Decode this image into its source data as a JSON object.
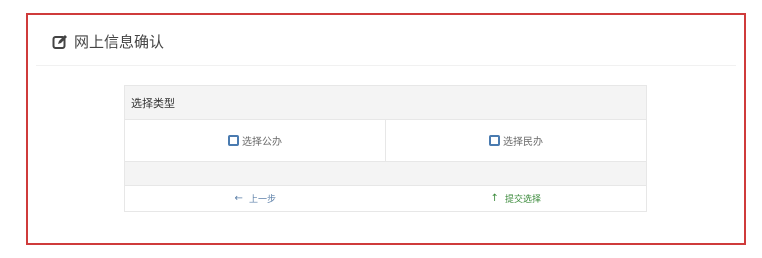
{
  "page": {
    "title": "网上信息确认"
  },
  "panel": {
    "header": "选择类型",
    "options": [
      {
        "label": "选择公办"
      },
      {
        "label": "选择民办"
      }
    ]
  },
  "actions": {
    "prev_label": "上一步",
    "submit_label": "提交选择",
    "prev_icon": "arrow-left-icon",
    "submit_icon": "arrow-up-icon"
  },
  "colors": {
    "frame_border": "#cf3b3b",
    "radio_border": "#4a7bb0",
    "prev_color": "#5b7fa8",
    "submit_color": "#3a8a3a"
  }
}
